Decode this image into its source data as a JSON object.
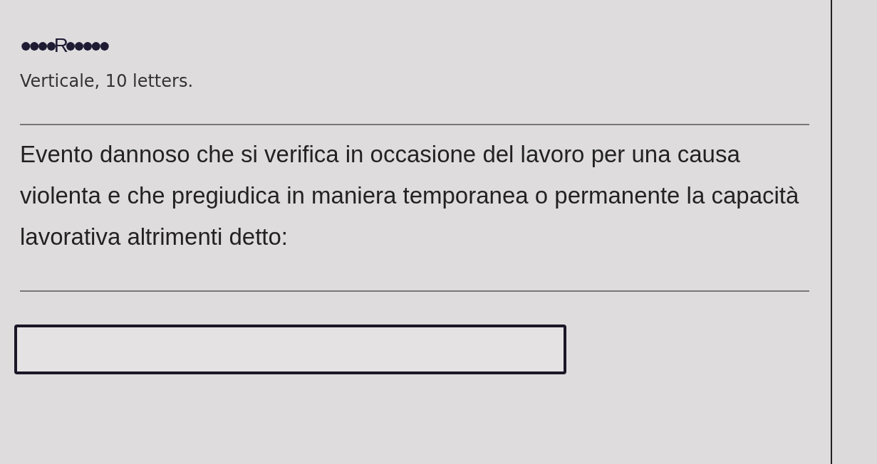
{
  "pattern": "●●●●R●●●●●",
  "hint": "Verticale, 10 letters.",
  "clue": "Evento dannoso che si verifica in occasione del lavoro per una causa violenta e che pregiudica in maniera temporanea o permanente la capacità lavorativa altrimenti detto:"
}
